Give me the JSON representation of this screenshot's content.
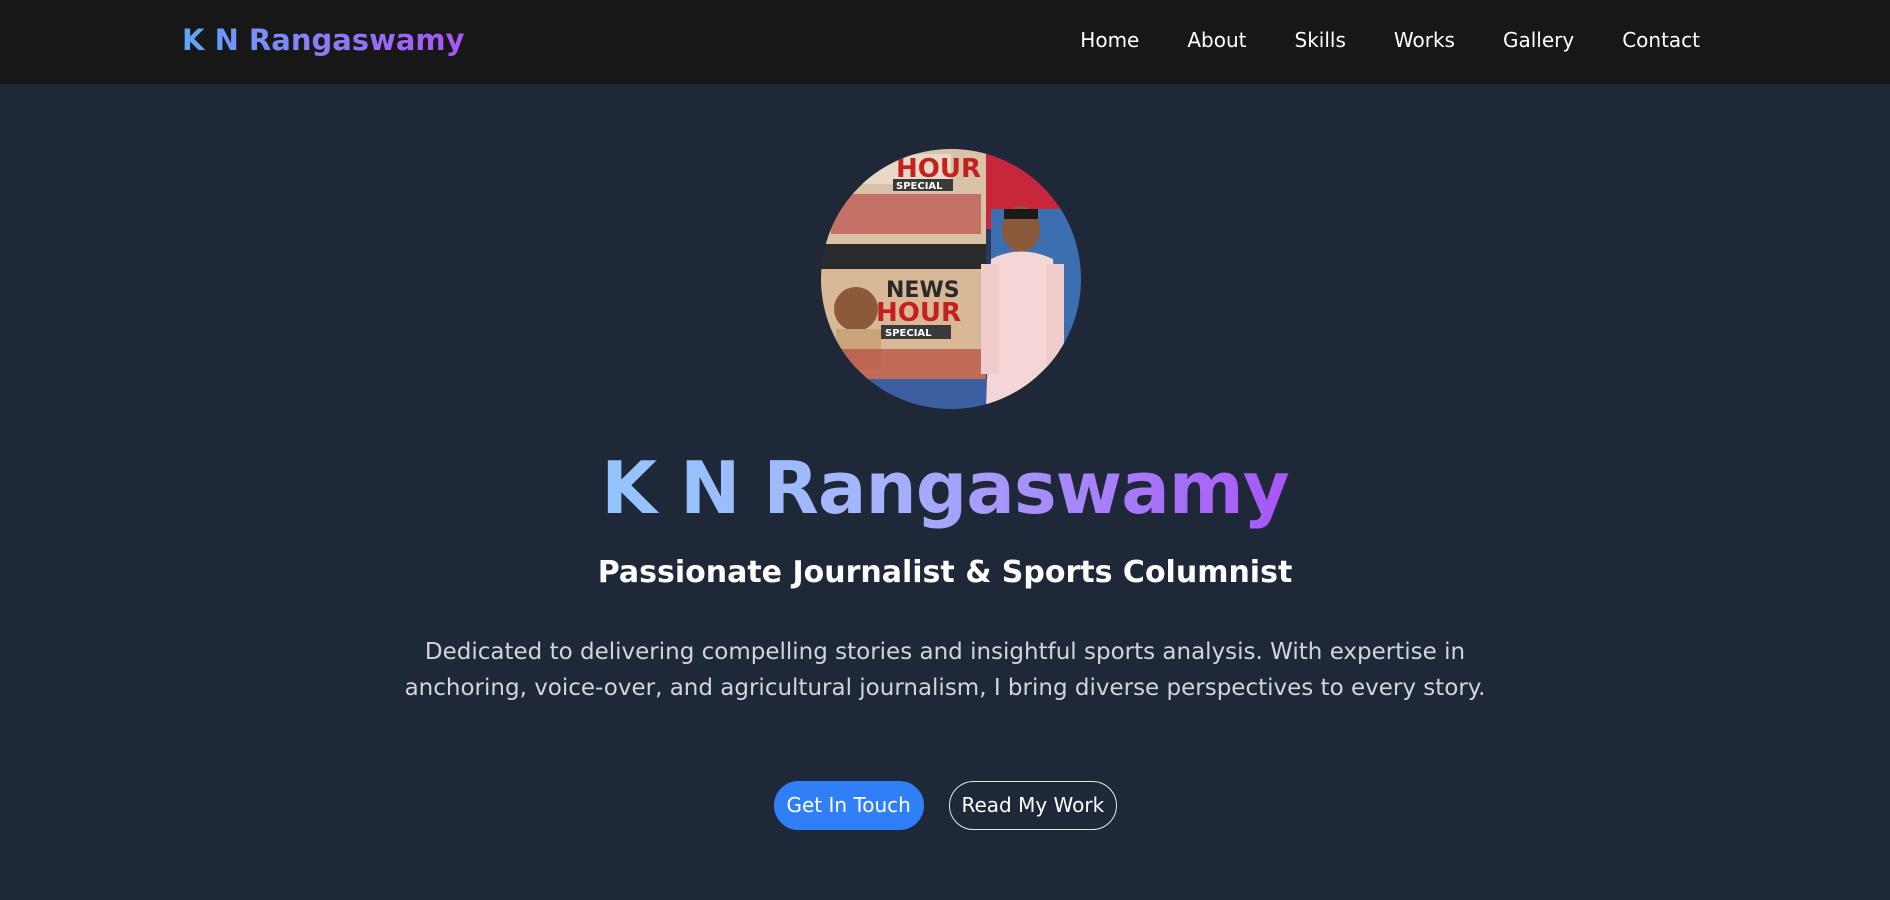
{
  "header": {
    "brand": "K N Rangaswamy",
    "nav": [
      "Home",
      "About",
      "Skills",
      "Works",
      "Gallery",
      "Contact"
    ]
  },
  "hero": {
    "title": "K N Rangaswamy",
    "subtitle": "Passionate Journalist & Sports Columnist",
    "description": "Dedicated to delivering compelling stories and insightful sports analysis. With expertise in anchoring, voice-over, and agricultural journalism, I bring diverse perspectives to every story.",
    "primary_button": "Get In Touch",
    "secondary_button": "Read My Work",
    "photo": {
      "screen_text_top": "HOUR",
      "screen_text_special": "SPECIAL",
      "screen_text_news": "NEWS",
      "screen_text_hour": "HOUR",
      "screen_text_special2": "SPECIAL"
    }
  },
  "colors": {
    "nav_bg": "#171717",
    "page_bg": "#1f2839",
    "accent_blue": "#2f80f6",
    "gradient_start": "#60a5fa",
    "gradient_end": "#a855f7"
  }
}
